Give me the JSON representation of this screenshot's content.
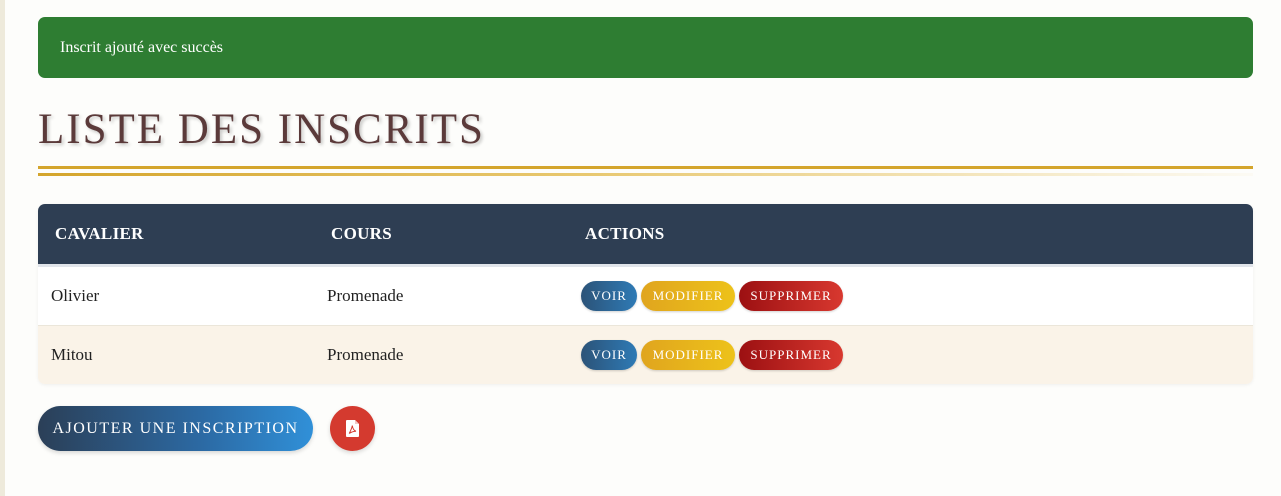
{
  "alert": {
    "message": "Inscrit ajouté avec succès"
  },
  "page": {
    "title": "LISTE DES INSCRITS"
  },
  "table": {
    "headers": [
      "CAVALIER",
      "COURS",
      "ACTIONS"
    ],
    "rows": [
      {
        "cavalier": "Olivier",
        "cours": "Promenade"
      },
      {
        "cavalier": "Mitou",
        "cours": "Promenade"
      }
    ],
    "actions": {
      "view_label": "VOIR",
      "edit_label": "MODIFIER",
      "delete_label": "SUPPRIMER"
    }
  },
  "footer": {
    "add_label": "AJOUTER UNE INSCRIPTION",
    "pdf_icon": "file-pdf-icon"
  },
  "colors": {
    "success": "#2e7d32",
    "header_bg": "#2e3e53",
    "gold": "#d4a52c",
    "view": "#2c5378",
    "edit": "#e0a51e",
    "delete": "#9c1012",
    "pdf": "#d43a2f"
  }
}
